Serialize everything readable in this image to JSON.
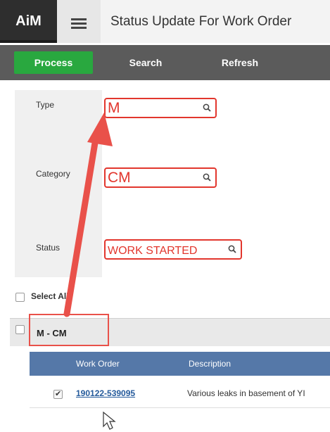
{
  "header": {
    "logo": "AiM",
    "title": "Status Update For Work Order"
  },
  "toolbar": {
    "process": "Process",
    "search": "Search",
    "refresh": "Refresh"
  },
  "form": {
    "type_label": "Type",
    "type_value": "M",
    "category_label": "Category",
    "category_value": "CM",
    "status_label": "Status",
    "status_value": "WORK STARTED"
  },
  "list": {
    "select_all": "Select All",
    "group_title": "M  -  CM",
    "columns": [
      "Work Order",
      "Description"
    ],
    "rows": [
      {
        "work_order": "190122-539095",
        "description": "Various leaks in basement of YI",
        "checked": true
      }
    ]
  },
  "colors": {
    "annotation": "#e9514a",
    "process_green": "#29a83f",
    "grid_header": "#5578a8"
  }
}
